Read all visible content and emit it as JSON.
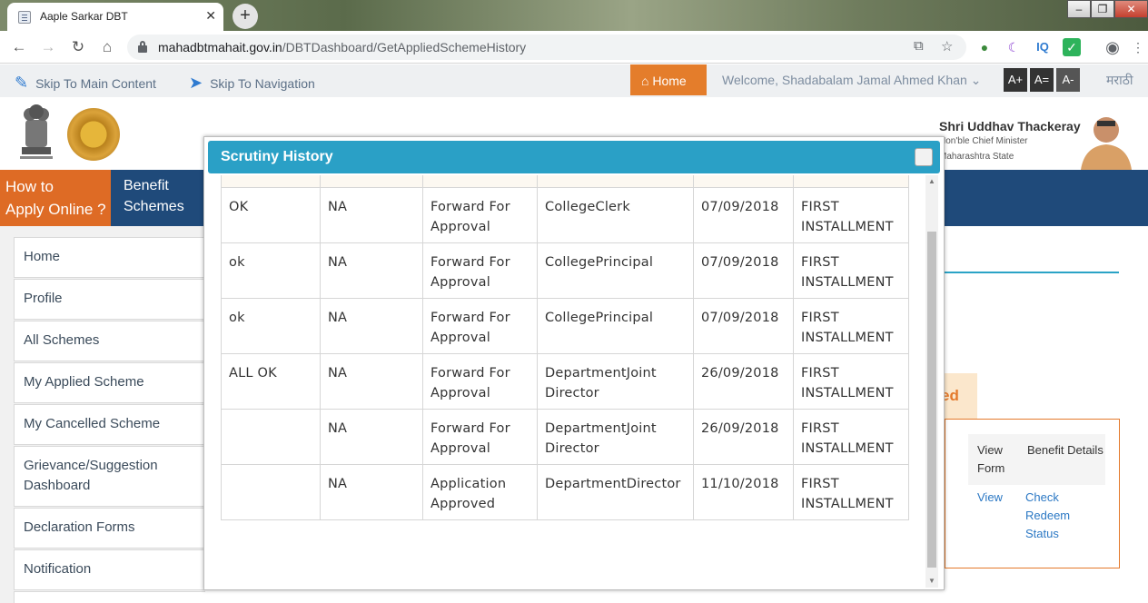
{
  "browser": {
    "tab_title": "Aaple Sarkar DBT",
    "tab_close": "✕",
    "new_tab": "+",
    "url_domain": "mahadbtmahait.gov.in",
    "url_path": "/DBTDashboard/GetAppliedSchemeHistory",
    "ext_iq": "IQ"
  },
  "access_bar": {
    "skip_main": "Skip To Main Content",
    "skip_nav": "Skip To Navigation",
    "home": "Home",
    "welcome": "Welcome, Shadabalam Jamal Ahmed Khan",
    "font_increase": "A+",
    "font_normal": "A=",
    "font_decrease": "A-",
    "language": "मराठी"
  },
  "header": {
    "cm_name": "Shri Uddhav Thackeray",
    "cm_title": "Hon'ble Chief Minister",
    "cm_state": "Maharashtra State"
  },
  "nav": {
    "how_to_line1": "How to",
    "how_to_line2": "Apply Online ?",
    "benefit_line1": "Benefit",
    "benefit_line2": "Schemes"
  },
  "sidebar": {
    "items": [
      {
        "label": "Home"
      },
      {
        "label": "Profile"
      },
      {
        "label": "All Schemes"
      },
      {
        "label": "My Applied Scheme"
      },
      {
        "label": "My Cancelled Scheme"
      },
      {
        "label": "Grievance/Suggestion Dashboard"
      },
      {
        "label": "Declaration Forms"
      },
      {
        "label": "Notification"
      }
    ]
  },
  "background_table": {
    "partial_status": "ed",
    "col_view_form": "View Form",
    "col_benefit": "Benefit Details",
    "view_link": "View",
    "check_link": "Check Redeem Status"
  },
  "modal": {
    "title": "Scrutiny History",
    "rows": [
      {
        "remark": "OK",
        "reason": "NA",
        "action": "Forward For Approval",
        "by": "CollegeClerk",
        "date": "07/09/2018",
        "installment": "FIRST INSTALLMENT"
      },
      {
        "remark": "ok",
        "reason": "NA",
        "action": "Forward For Approval",
        "by": "CollegePrincipal",
        "date": "07/09/2018",
        "installment": "FIRST INSTALLMENT"
      },
      {
        "remark": "ok",
        "reason": "NA",
        "action": "Forward For Approval",
        "by": "CollegePrincipal",
        "date": "07/09/2018",
        "installment": "FIRST INSTALLMENT"
      },
      {
        "remark": "ALL OK",
        "reason": "NA",
        "action": "Forward For Approval",
        "by": "DepartmentJoint Director",
        "date": "26/09/2018",
        "installment": "FIRST INSTALLMENT"
      },
      {
        "remark": "",
        "reason": "NA",
        "action": "Forward For Approval",
        "by": "DepartmentJoint Director",
        "date": "26/09/2018",
        "installment": "FIRST INSTALLMENT"
      },
      {
        "remark": "",
        "reason": "NA",
        "action": "Application Approved",
        "by": "DepartmentDirector",
        "date": "11/10/2018",
        "installment": "FIRST INSTALLMENT"
      }
    ]
  }
}
